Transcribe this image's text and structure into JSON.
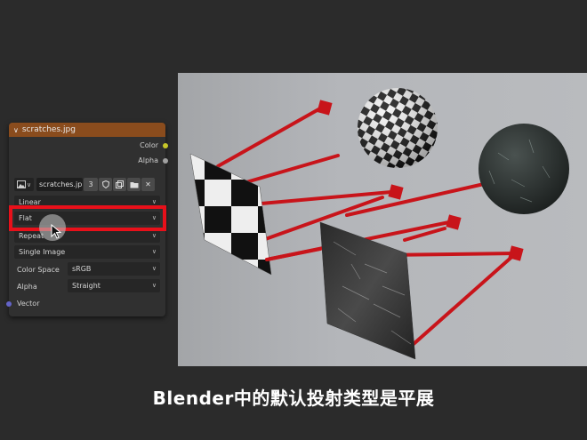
{
  "node": {
    "title": "scratches.jpg",
    "outputs": [
      "Color",
      "Alpha"
    ],
    "image_name": "scratches.jp",
    "users_count": "3",
    "interpolation": "Linear",
    "projection": "Flat",
    "extension": "Repeat",
    "source": "Single Image",
    "color_space_label": "Color Space",
    "color_space_value": "sRGB",
    "alpha_label": "Alpha",
    "alpha_value": "Straight",
    "input_vector": "Vector"
  },
  "colors": {
    "node_header": "#8a4c1d",
    "highlight": "#e8101a",
    "color_socket": "#c7c729",
    "alpha_socket": "#a0a0a0",
    "vector_socket": "#6363c7",
    "arrow": "#c8141a"
  },
  "subtitle": "Blender中的默认投射类型是平展"
}
